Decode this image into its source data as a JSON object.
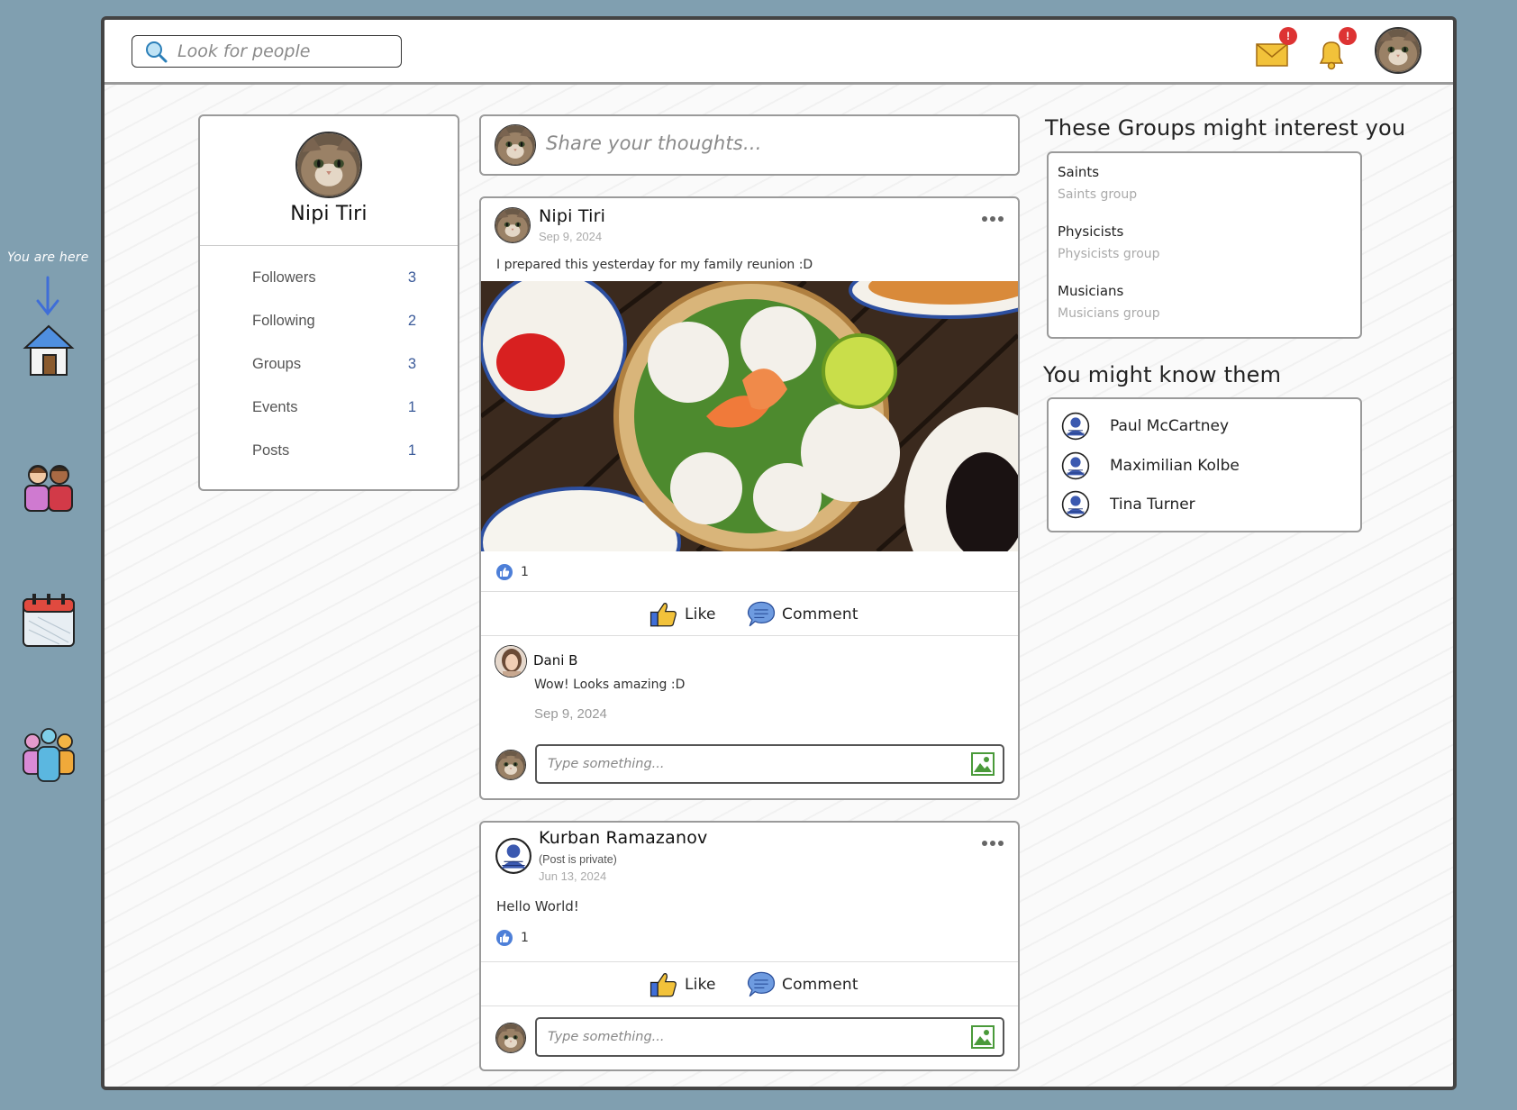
{
  "rail": {
    "here_label": "You are here",
    "items": [
      {
        "name": "home",
        "icon": "home-icon"
      },
      {
        "name": "friends",
        "icon": "friends-icon"
      },
      {
        "name": "events",
        "icon": "calendar-icon"
      },
      {
        "name": "groups",
        "icon": "groups-icon"
      }
    ]
  },
  "header": {
    "search_placeholder": "Look for people",
    "messages_badge": "!",
    "notifications_badge": "!"
  },
  "profile": {
    "name": "Nipi Tiri",
    "stats": [
      {
        "label": "Followers",
        "value": "3"
      },
      {
        "label": "Following",
        "value": "2"
      },
      {
        "label": "Groups",
        "value": "3"
      },
      {
        "label": "Events",
        "value": "1"
      },
      {
        "label": "Posts",
        "value": "1"
      }
    ]
  },
  "composer": {
    "placeholder": "Share your thoughts..."
  },
  "posts": [
    {
      "author": "Nipi Tiri",
      "date": "Sep 9, 2024",
      "text": "I prepared this yesterday for my family reunion :D",
      "likes": "1",
      "like_label": "Like",
      "comment_label": "Comment",
      "comments": [
        {
          "author": "Dani B",
          "text": "Wow! Looks amazing :D",
          "date": "Sep 9, 2024"
        }
      ],
      "reply_placeholder": "Type something..."
    },
    {
      "author": "Kurban Ramazanov",
      "privacy": "(Post is private)",
      "date": "Jun 13, 2024",
      "text": "Hello World!",
      "likes": "1",
      "like_label": "Like",
      "comment_label": "Comment",
      "reply_placeholder": "Type something..."
    }
  ],
  "groups_section": {
    "title": "These Groups might interest you",
    "items": [
      {
        "name": "Saints",
        "desc": "Saints group"
      },
      {
        "name": "Physicists",
        "desc": "Physicists group"
      },
      {
        "name": "Musicians",
        "desc": "Musicians group"
      }
    ]
  },
  "people_section": {
    "title": "You might know them",
    "items": [
      "Paul McCartney",
      "Maximilian Kolbe",
      "Tina Turner"
    ]
  },
  "colors": {
    "background": "#809fb0",
    "accent": "#3a5a99",
    "badge": "#dd3333"
  }
}
